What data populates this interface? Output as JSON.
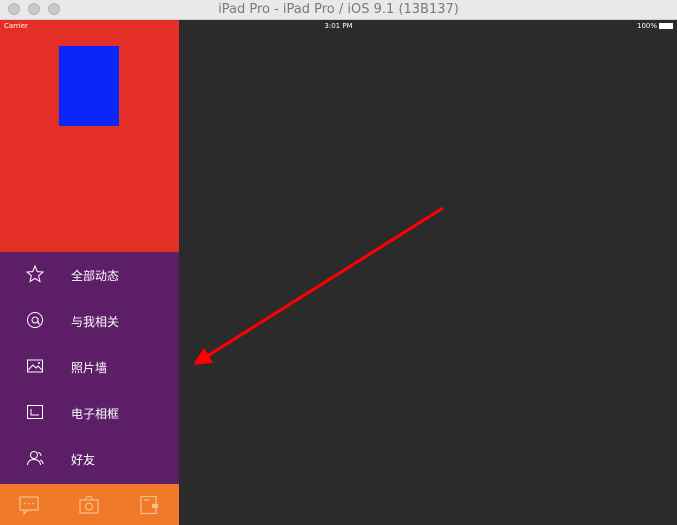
{
  "window": {
    "title": "iPad Pro - iPad Pro / iOS 9.1 (13B137)"
  },
  "status_bar": {
    "carrier": "Carrier",
    "time": "3:01 PM",
    "battery": "100%"
  },
  "menu": {
    "items": [
      {
        "label": "全部动态",
        "icon": "star-icon"
      },
      {
        "label": "与我相关",
        "icon": "at-icon"
      },
      {
        "label": "照片墙",
        "icon": "photo-icon"
      },
      {
        "label": "电子相框",
        "icon": "frame-icon"
      },
      {
        "label": "好友",
        "icon": "friends-icon"
      }
    ]
  },
  "tab_bar": {
    "icons": [
      "chat-icon",
      "camera-icon",
      "contacts-icon"
    ]
  },
  "colors": {
    "header": "#e42f27",
    "avatar": "#0a27fb",
    "menu": "#5d1e68",
    "tab_bar": "#f07a2a",
    "content": "#2b2b2b",
    "annotation_arrow": "#ff0000"
  }
}
